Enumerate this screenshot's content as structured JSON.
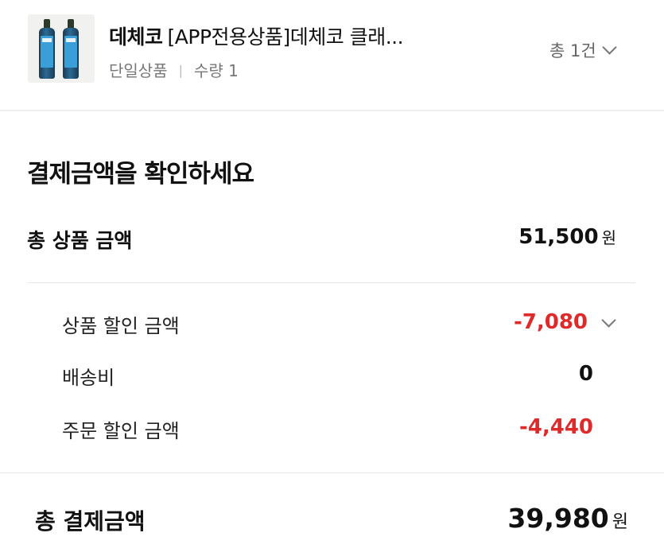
{
  "product": {
    "brand": "데체코",
    "name": "[APP전용상품]데체코 클래...",
    "option": "단일상품",
    "separator": "|",
    "quantity": "수량 1",
    "count": "총 1건"
  },
  "payment": {
    "title": "결제금액을 확인하세요",
    "currency": "원",
    "total_goods": {
      "label": "총 상품 금액",
      "value": "51,500"
    },
    "product_discount": {
      "label": "상품 할인 금액",
      "value": "-7,080"
    },
    "shipping": {
      "label": "배송비",
      "value": "0"
    },
    "order_discount": {
      "label": "주문 할인 금액",
      "value": "-4,440"
    },
    "grand_total": {
      "label": "총 결제금액",
      "value": "39,980"
    }
  },
  "colors": {
    "discount": "#e02a2a",
    "text": "#111111",
    "muted": "#777777",
    "bottle_label": "#3a9fd6"
  },
  "icons": {
    "count_toggle": "chevron-down-icon",
    "discount_toggle": "chevron-down-icon"
  }
}
